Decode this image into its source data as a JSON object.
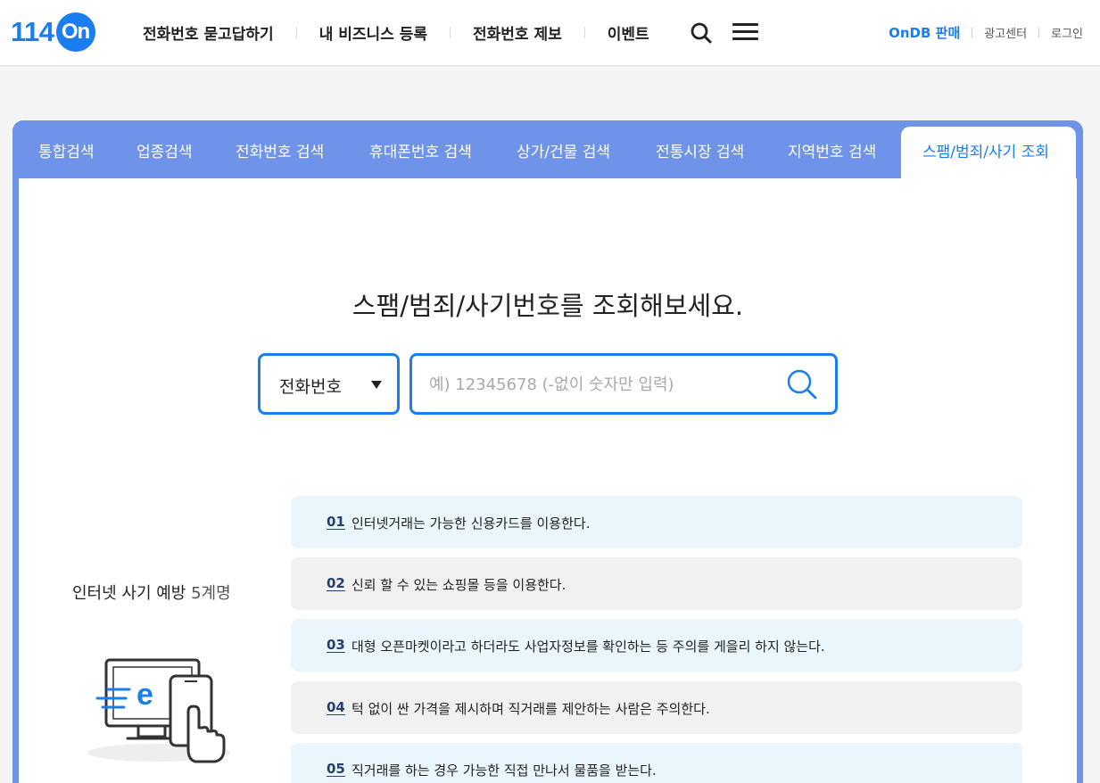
{
  "header": {
    "logo_number": "114",
    "logo_circle": "On",
    "nav": [
      "전화번호 묻고답하기",
      "내 비즈니스 등록",
      "전화번호 제보",
      "이벤트"
    ],
    "ondb": "OnDB 판매",
    "ad_center": "광고센터",
    "login": "로그인"
  },
  "tabs": [
    "통합검색",
    "업종검색",
    "전화번호 검색",
    "휴대폰번호 검색",
    "상가/건물 검색",
    "전통시장 검색",
    "지역번호 검색"
  ],
  "active_tab": "스팸/범죄/사기 조회",
  "main": {
    "title": "스팸/범죄/사기번호를 조회해보세요.",
    "select_value": "전화번호",
    "search_placeholder": "예) 12345678 (-없이 숫자만 입력)"
  },
  "tips": {
    "title_main": "인터넷 사기 예방",
    "title_accent": "5계명",
    "items": [
      {
        "num": "01",
        "text": "인터넷거래는 가능한 신용카드를 이용한다."
      },
      {
        "num": "02",
        "text": "신뢰 할 수 있는 쇼핑몰 등을 이용한다."
      },
      {
        "num": "03",
        "text": "대형 오픈마켓이라고 하더라도 사업자정보를 확인하는 등 주의를 게을리 하지 않는다."
      },
      {
        "num": "04",
        "text": "턱 없이 싼 가격을 제시하며 직거래를 제안하는 사람은 주의한다."
      },
      {
        "num": "05",
        "text": "직거래를 하는 경우 가능한 직접 만나서 물품을 받는다."
      }
    ]
  },
  "colors": {
    "brand": "#1b7ef0",
    "tab_bar": "#6f93e9",
    "tip_blue": "#eaf5fc",
    "tip_gray": "#f1f1f1"
  }
}
